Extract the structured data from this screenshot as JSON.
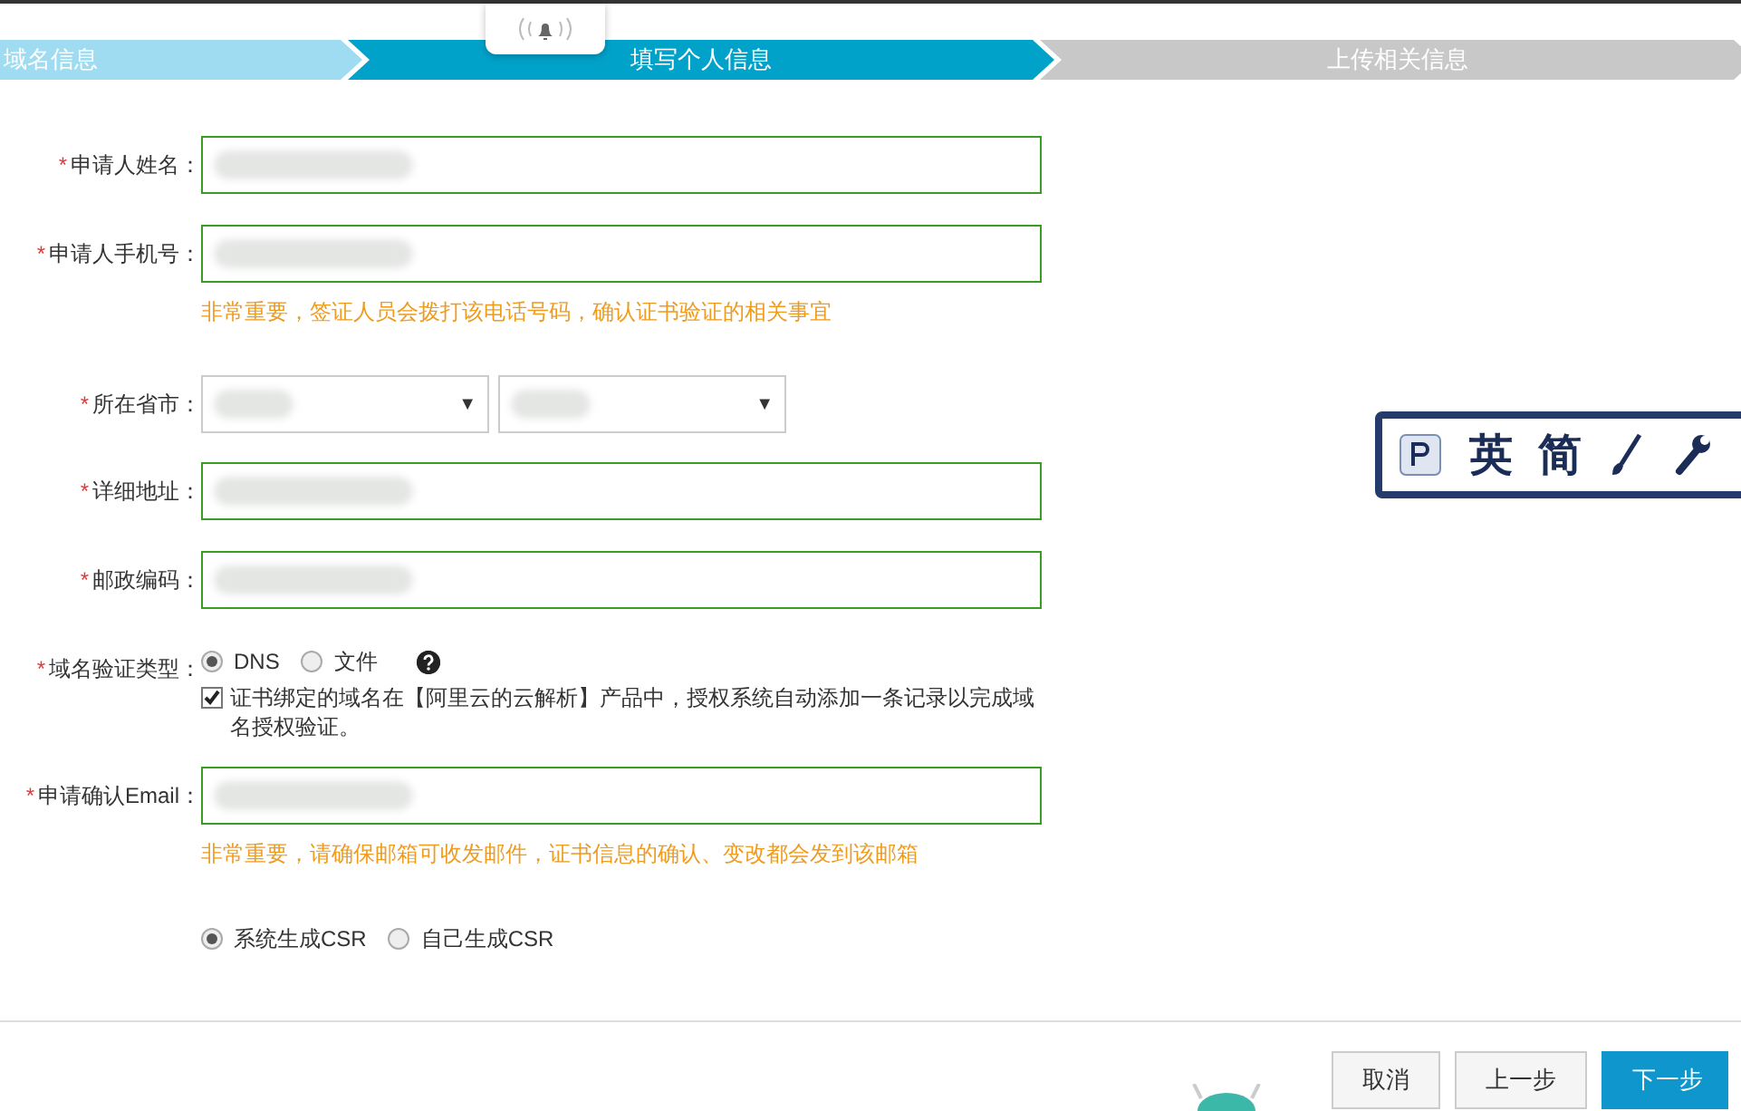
{
  "steps": [
    {
      "label": "域名信息",
      "completed": true,
      "selected": false
    },
    {
      "label": "填写个人信息",
      "completed": false,
      "selected": true
    },
    {
      "label": "上传相关信息",
      "completed": false,
      "selected": false
    }
  ],
  "form": {
    "fields": [
      {
        "kind": "text",
        "marker": "*",
        "label": "申请人姓名：",
        "redacted": true
      },
      {
        "kind": "text",
        "marker": "*",
        "label": "申请人手机号：",
        "redacted": true,
        "hint": "非常重要，签证人员会拨打该电话号码，确认证书验证的相关事宜"
      },
      {
        "kind": "selects",
        "marker": "*",
        "label": "所在省市：",
        "redacted": true,
        "selects": [
          "▼",
          "▼"
        ]
      },
      {
        "kind": "text",
        "marker": "*",
        "label": "详细地址：",
        "redacted": true
      },
      {
        "kind": "text",
        "marker": "*",
        "label": "邮政编码：",
        "redacted": true
      },
      {
        "kind": "validation",
        "marker": "*",
        "label": "域名验证类型：",
        "options": [
          {
            "label": "DNS",
            "selected": true
          },
          {
            "label": "文件",
            "selected": false
          }
        ],
        "checkbox": {
          "label": "证书绑定的域名在【阿里云的云解析】产品中，授权系统自动添加一条记录以完成域名授权验证。",
          "checked": true
        }
      },
      {
        "kind": "text",
        "marker": "*",
        "label": "申请确认Email：",
        "redacted": true,
        "hint": "非常重要，请确保邮箱可收发邮件，证书信息的确认、变改都会发到该邮箱"
      },
      {
        "kind": "radios",
        "options": [
          {
            "label": "系统生成CSR",
            "selected": true
          },
          {
            "label": "自己生成CSR",
            "selected": false
          }
        ]
      }
    ]
  },
  "ime_toolbar": {
    "labels": [
      "英",
      "简"
    ]
  },
  "buttons": [
    {
      "label": "取消",
      "primary": false
    },
    {
      "label": "上一步",
      "primary": false
    },
    {
      "label": "下一步",
      "primary": true
    }
  ]
}
